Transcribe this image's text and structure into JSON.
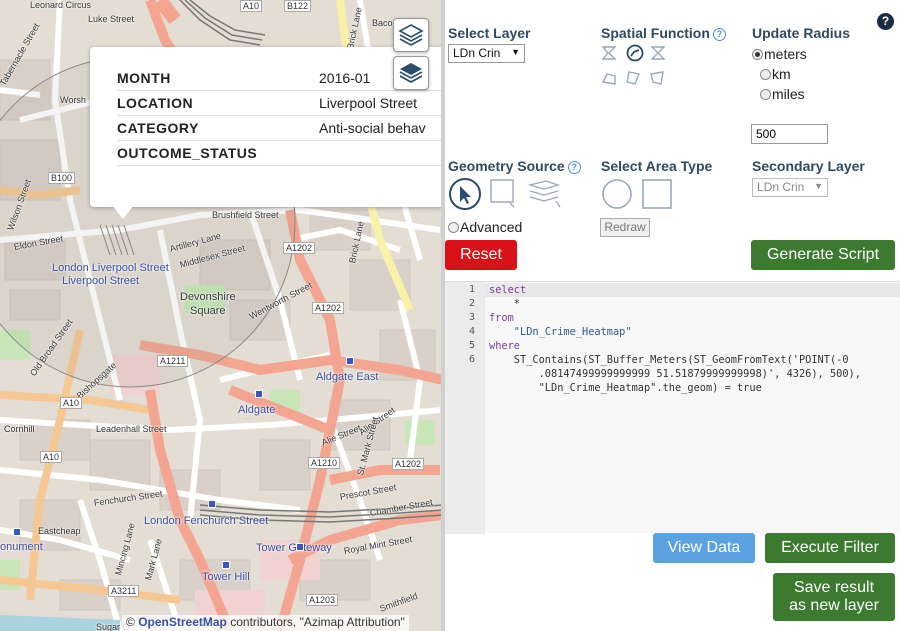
{
  "map": {
    "labels": {
      "leonard_circus": "Leonard Circus",
      "luke_street": "Luke Street",
      "worship": "Worsh",
      "tabernacle": "Tabernacle Street",
      "wilson": "Wilson Street",
      "eldon": "Eldon Street",
      "broad": "Old Broad Street",
      "lpool_station": "London Liverpool Street",
      "lpool_street": "Liverpool Street",
      "devonshire": "Devonshire",
      "square": "Square",
      "bishopsgate": "Bishopsgate",
      "brushfield": "Brushfield Street",
      "artillery": "Artillery Lane",
      "middlesex": "Middlesex Street",
      "wentworth": "Wentworth Street",
      "brick_lane": "Brick Lane",
      "aldgate_east": "Aldgate East",
      "aldgate": "Aldgate",
      "alie": "Alie Street",
      "mark": "St. Mark Street",
      "cornhill": "Cornhill",
      "leadenhall": "Leadenhall Street",
      "fenchurch": "Fenchurch Street",
      "lfenchurch": "London Fenchurch Street",
      "eastcheap": "Eastcheap",
      "monument": "onument",
      "mincing": "Mincing Lane",
      "mark_lane": "Mark Lane",
      "tower_gateway": "Tower Gateway",
      "royal_mint": "Royal Mint Street",
      "prescot": "Prescot Street",
      "chamber": "Chamber Street",
      "tower_hill": "Tower Hill",
      "sugar": "Sugar Q",
      "baco": "Baco",
      "brick_top": "Brick Lane",
      "smithfield": "Smithfield"
    },
    "shields": {
      "a10_top": "A10",
      "b122": "B122",
      "b100": "B100",
      "a1202_a": "A1202",
      "a1202_b": "A1202",
      "a1211": "A1211",
      "a10_b": "A10",
      "a10_c": "A10",
      "a1210": "A1210",
      "a1202_c": "A1202",
      "a3211": "A3211",
      "a1203": "A1203"
    },
    "popup": {
      "rows": [
        {
          "key": "MONTH",
          "value": "2016-01"
        },
        {
          "key": "LOCATION",
          "value": "Liverpool Street"
        },
        {
          "key": "CATEGORY",
          "value": "Anti-social behav"
        },
        {
          "key": "OUTCOME_STATUS",
          "value": ""
        }
      ]
    },
    "attribution": {
      "prefix": "©",
      "osm": "OpenStreetMap",
      "rest": "contributors, \"Azimap Attribution\""
    }
  },
  "panel": {
    "select_layer": {
      "label": "Select Layer",
      "value": "LDn Crin"
    },
    "spatial_function": {
      "label": "Spatial Function",
      "help": "?"
    },
    "update_radius": {
      "label": "Update Radius",
      "options": [
        "meters",
        "km",
        "miles"
      ],
      "selected": "meters",
      "value": "500"
    },
    "help": "?",
    "geometry_source": {
      "label": "Geometry Source",
      "help": "?",
      "advanced": "Advanced"
    },
    "select_area_type": {
      "label": "Select Area Type",
      "redraw": "Redraw"
    },
    "secondary_layer": {
      "label": "Secondary Layer",
      "value": "LDn Crin"
    },
    "reset": "Reset",
    "generate_script": "Generate Script",
    "view_data": "View Data",
    "execute_filter": "Execute Filter",
    "save_line1": "Save result",
    "save_line2": "as new layer"
  },
  "editor": {
    "line_numbers": [
      "1",
      "2",
      "3",
      "4",
      "5",
      "6"
    ],
    "lines": {
      "l1": "select",
      "l2": "    *",
      "l3": "from",
      "l4": "    \"LDn_Crime_Heatmap\"",
      "l5": "where",
      "l6a": "    ST_Contains(ST_Buffer_Meters(ST_GeomFromText('POINT(-0",
      "l6b": "        .08147499999999999 51.51879999999998)', 4326), 500),",
      "l6c": "        \"LDn_Crime_Heatmap\".the_geom) = true"
    }
  },
  "colors": {
    "reset": "#d9121a",
    "green": "#3b7a2f",
    "blue": "#5aa3e0",
    "header": "#2f4a63"
  }
}
